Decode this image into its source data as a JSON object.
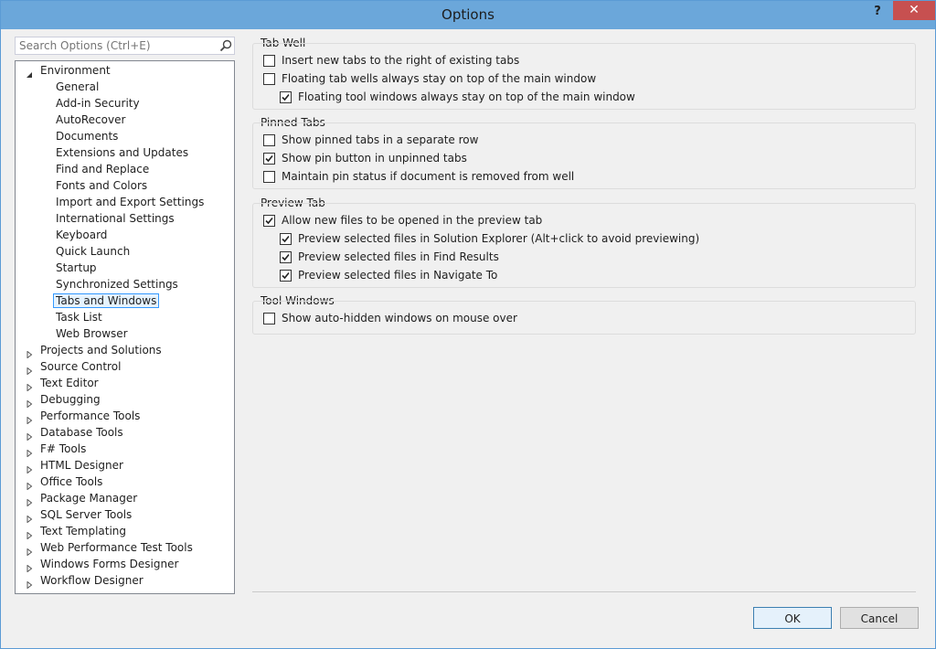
{
  "window": {
    "title": "Options",
    "help_label": "?",
    "close_label": "✕"
  },
  "search": {
    "placeholder": "Search Options (Ctrl+E)"
  },
  "tree": {
    "environment": "Environment",
    "env_children": [
      "General",
      "Add-in Security",
      "AutoRecover",
      "Documents",
      "Extensions and Updates",
      "Find and Replace",
      "Fonts and Colors",
      "Import and Export Settings",
      "International Settings",
      "Keyboard",
      "Quick Launch",
      "Startup",
      "Synchronized Settings",
      "Tabs and Windows",
      "Task List",
      "Web Browser"
    ],
    "selected": "Tabs and Windows",
    "top_level": [
      "Projects and Solutions",
      "Source Control",
      "Text Editor",
      "Debugging",
      "Performance Tools",
      "Database Tools",
      "F# Tools",
      "HTML Designer",
      "Office Tools",
      "Package Manager",
      "SQL Server Tools",
      "Text Templating",
      "Web Performance Test Tools",
      "Windows Forms Designer",
      "Workflow Designer"
    ]
  },
  "groups": {
    "tab_well": {
      "title": "Tab Well",
      "options": [
        {
          "label": "Insert new tabs to the right of existing tabs",
          "checked": false,
          "indent": 0
        },
        {
          "label": "Floating tab wells always stay on top of the main window",
          "checked": false,
          "indent": 0
        },
        {
          "label": "Floating tool windows always stay on top of the main window",
          "checked": true,
          "indent": 1
        }
      ]
    },
    "pinned_tabs": {
      "title": "Pinned Tabs",
      "options": [
        {
          "label": "Show pinned tabs in a separate row",
          "checked": false,
          "indent": 0
        },
        {
          "label": "Show pin button in unpinned tabs",
          "checked": true,
          "indent": 0
        },
        {
          "label": "Maintain pin status if document is removed from well",
          "checked": false,
          "indent": 0
        }
      ]
    },
    "preview_tab": {
      "title": "Preview Tab",
      "options": [
        {
          "label": "Allow new files to be opened in the preview tab",
          "checked": true,
          "indent": 0
        },
        {
          "label": "Preview selected files in Solution Explorer (Alt+click to avoid previewing)",
          "checked": true,
          "indent": 1
        },
        {
          "label": "Preview selected files in Find Results",
          "checked": true,
          "indent": 1
        },
        {
          "label": "Preview selected files in Navigate To",
          "checked": true,
          "indent": 1
        }
      ]
    },
    "tool_windows": {
      "title": "Tool Windows",
      "options": [
        {
          "label": "Show auto-hidden windows on mouse over",
          "checked": false,
          "indent": 0
        }
      ]
    }
  },
  "buttons": {
    "ok": "OK",
    "cancel": "Cancel"
  }
}
